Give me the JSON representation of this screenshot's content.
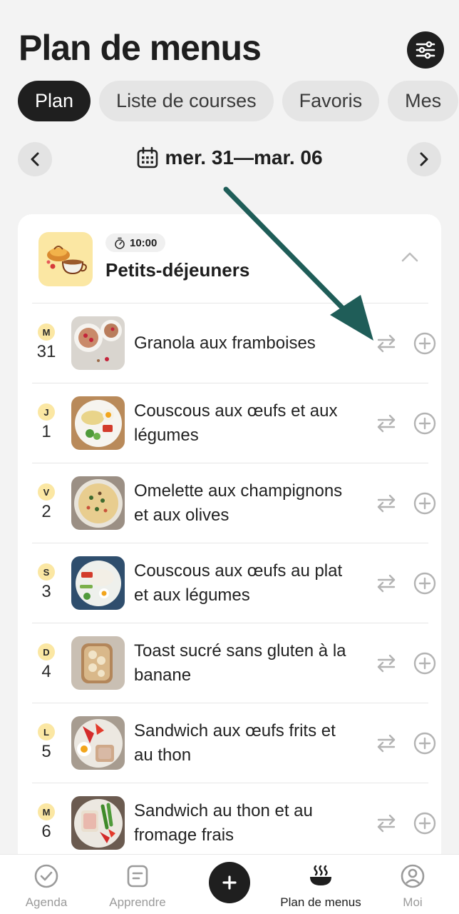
{
  "header": {
    "title": "Plan de menus"
  },
  "tabs": [
    {
      "label": "Plan",
      "active": true
    },
    {
      "label": "Liste de courses",
      "active": false
    },
    {
      "label": "Favoris",
      "active": false
    },
    {
      "label": "Mes",
      "active": false
    }
  ],
  "date_nav": {
    "range": "mer. 31—mar. 06"
  },
  "meal": {
    "time": "10:00",
    "title": "Petits-déjeuners",
    "rows": [
      {
        "day_letter": "M",
        "day_num": "31",
        "recipe": "Granola aux framboises"
      },
      {
        "day_letter": "J",
        "day_num": "1",
        "recipe": "Couscous aux œufs et aux légumes"
      },
      {
        "day_letter": "V",
        "day_num": "2",
        "recipe": "Omelette aux champignons et aux olives"
      },
      {
        "day_letter": "S",
        "day_num": "3",
        "recipe": "Couscous aux œufs au plat et aux légumes"
      },
      {
        "day_letter": "D",
        "day_num": "4",
        "recipe": "Toast sucré sans gluten à la banane"
      },
      {
        "day_letter": "L",
        "day_num": "5",
        "recipe": "Sandwich aux œufs frits et au thon"
      },
      {
        "day_letter": "M",
        "day_num": "6",
        "recipe": "Sandwich au thon et au fromage frais"
      }
    ]
  },
  "bottom_nav": [
    {
      "label": "Agenda",
      "icon": "check-circle-icon"
    },
    {
      "label": "Apprendre",
      "icon": "notes-icon"
    },
    {
      "label": "Plan de menus",
      "icon": "bowl-icon",
      "active": true
    },
    {
      "label": "Moi",
      "icon": "profile-icon"
    }
  ],
  "colors": {
    "accent_dark": "#1f1f1f",
    "day_badge": "#fbe7a3",
    "annotation_arrow": "#1f5d58"
  }
}
